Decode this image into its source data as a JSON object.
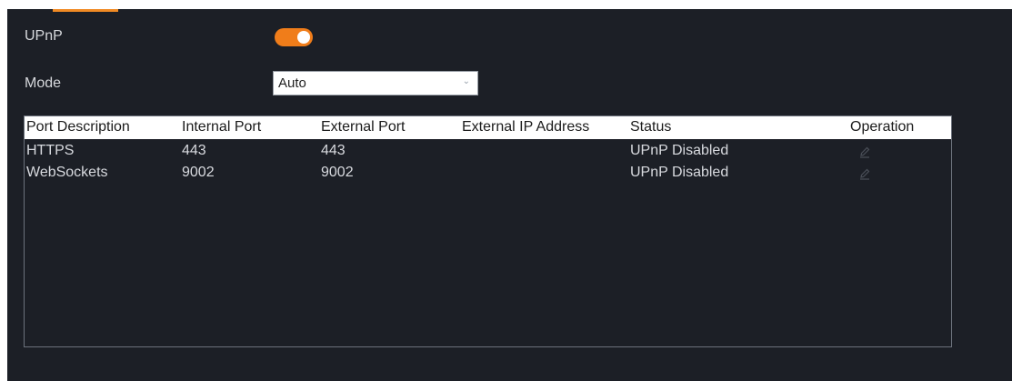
{
  "upnp": {
    "label": "UPnP",
    "enabled": true
  },
  "mode": {
    "label": "Mode",
    "value": "Auto"
  },
  "table": {
    "columns": [
      "Port Description",
      "Internal Port",
      "External Port",
      "External IP Address",
      "Status",
      "Operation"
    ],
    "rows": [
      {
        "description": "HTTPS",
        "internal": "443",
        "external": "443",
        "external_ip": "",
        "status": "UPnP Disabled",
        "operation": "edit-icon"
      },
      {
        "description": "WebSockets",
        "internal": "9002",
        "external": "9002",
        "external_ip": "",
        "status": "UPnP Disabled",
        "operation": "edit-icon"
      }
    ]
  },
  "colors": {
    "accent": "#f07d1a",
    "background": "#1c1f26",
    "header_bg": "#ffffff"
  }
}
